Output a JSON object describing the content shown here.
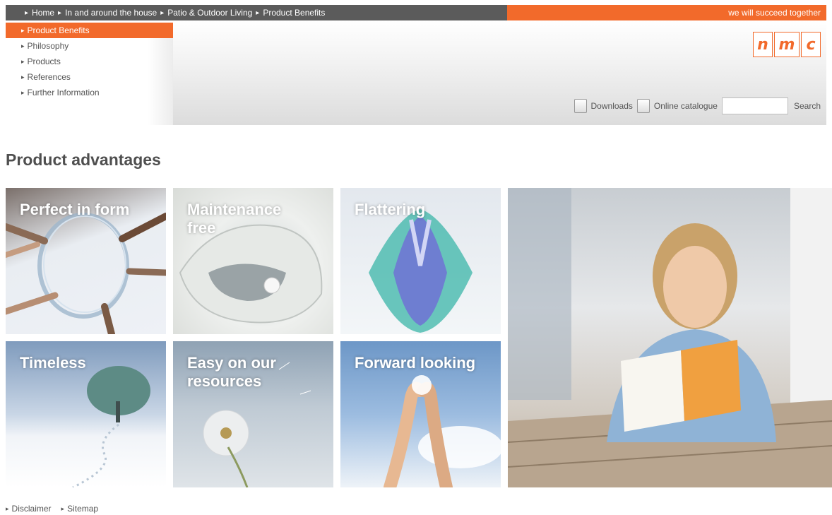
{
  "breadcrumb": {
    "items": [
      "Home",
      "In and around the house",
      "Patio & Outdoor Living",
      "Product Benefits"
    ]
  },
  "slogan": "we will succeed together",
  "menu": {
    "items": [
      {
        "label": "Product Benefits",
        "active": true
      },
      {
        "label": "Philosophy",
        "active": false
      },
      {
        "label": "Products",
        "active": false
      },
      {
        "label": "References",
        "active": false
      },
      {
        "label": "Further Information",
        "active": false
      }
    ]
  },
  "logo": {
    "letters": [
      "n",
      "m",
      "c"
    ],
    "color": "#f26a2b"
  },
  "tools": {
    "downloads_label": "Downloads",
    "catalogue_label": "Online catalogue",
    "search_value": "",
    "search_label": "Search"
  },
  "page_title": "Product advantages",
  "tiles": [
    {
      "label": "Perfect in form"
    },
    {
      "label": "Maintenance free"
    },
    {
      "label": "Flattering"
    },
    {
      "label": "Timeless"
    },
    {
      "label": "Easy on our resources"
    },
    {
      "label": "Forward looking"
    }
  ],
  "footer": {
    "links": [
      "Disclaimer",
      "Sitemap"
    ]
  },
  "colors": {
    "accent": "#f26a2b",
    "breadcrumb_bg": "#5b5b5b",
    "title": "#4f4f4f"
  }
}
